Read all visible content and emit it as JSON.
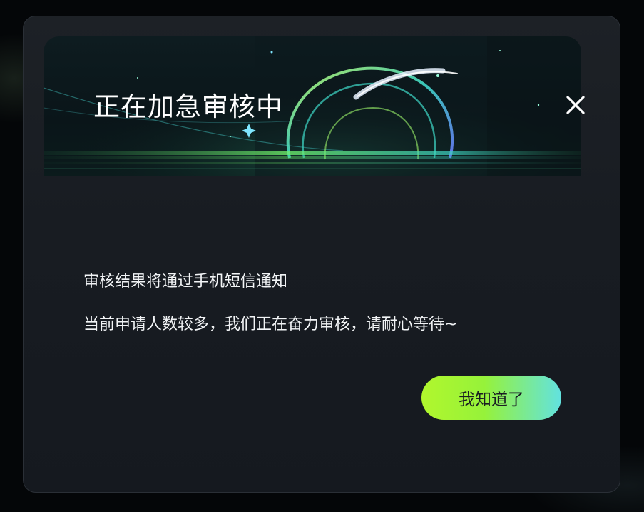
{
  "dialog": {
    "title": "正在加急审核中",
    "close_icon": "close-icon",
    "message_line_1": "审核结果将通过手机短信通知",
    "message_line_2": "当前申请人数较多，我们正在奋力审核，请耐心等待~",
    "confirm_label": "我知道了"
  },
  "colors": {
    "dialog_background": "#1b1f25",
    "text": "#f2f4f6",
    "button_gradient_start": "#b1f72d",
    "button_gradient_end": "#62e2e0"
  }
}
